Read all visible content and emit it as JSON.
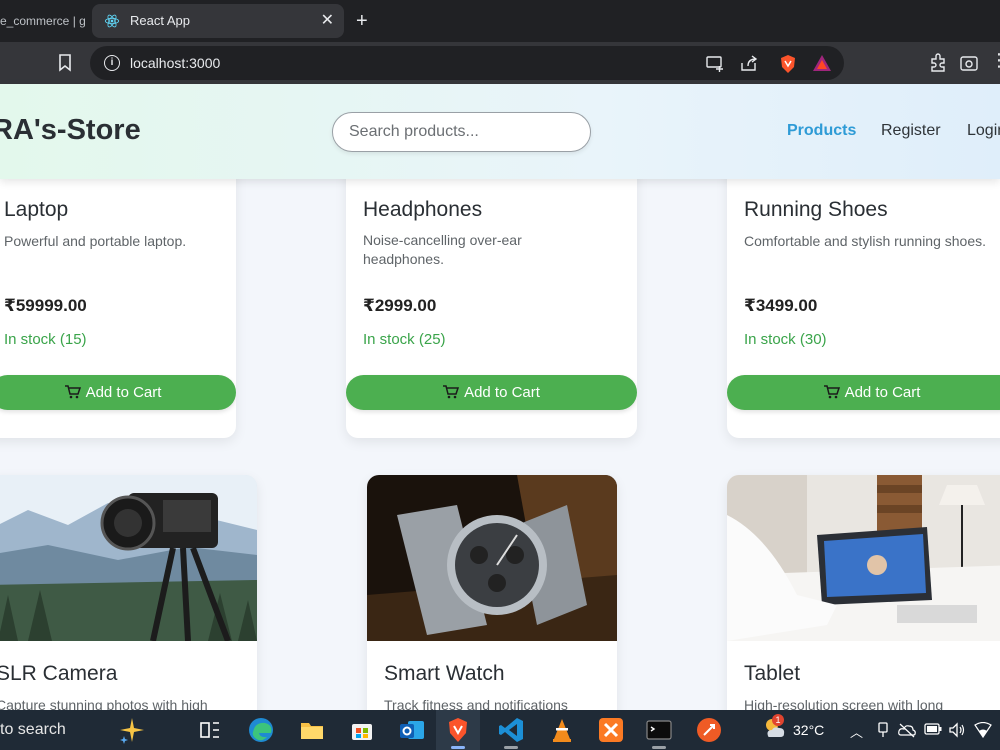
{
  "browser": {
    "inactive_tab_title": "e_commerce | g",
    "active_tab_title": "React App",
    "url": "localhost:3000"
  },
  "header": {
    "brand": "RA's-Store",
    "search_placeholder": "Search products...",
    "nav": [
      {
        "label": "Products",
        "active": true
      },
      {
        "label": "Register",
        "active": false
      },
      {
        "label": "Login",
        "active": false
      }
    ]
  },
  "products_row1": [
    {
      "name": "Laptop",
      "description": "Powerful and portable laptop.",
      "price": "₹59999.00",
      "stock": "In stock (15)",
      "cart_label": "Add to Cart"
    },
    {
      "name": "Headphones",
      "description": "Noise-cancelling over-ear headphones.",
      "price": "₹2999.00",
      "stock": "In stock (25)",
      "cart_label": "Add to Cart"
    },
    {
      "name": "Running Shoes",
      "description": "Comfortable and stylish running shoes.",
      "price": "₹3499.00",
      "stock": "In stock (30)",
      "cart_label": "Add to Cart"
    }
  ],
  "products_row2": [
    {
      "name": "SLR Camera",
      "description": "Capture stunning photos with high"
    },
    {
      "name": "Smart Watch",
      "description": "Track fitness and notifications"
    },
    {
      "name": "Tablet",
      "description": "High-resolution screen with long"
    }
  ],
  "taskbar": {
    "search_label": "to search",
    "weather": "32°C",
    "edge_badge": "1"
  },
  "colors": {
    "accent_green": "#4caf50",
    "nav_active": "#2e9bd6",
    "stock_green": "#3aa44a"
  }
}
